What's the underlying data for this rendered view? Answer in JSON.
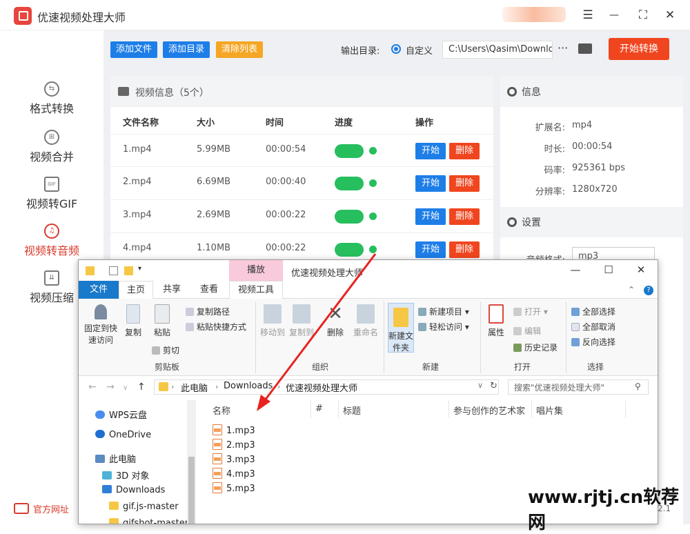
{
  "app": {
    "title": "优速视频处理大师",
    "window_controls": {
      "menu": "☰",
      "minimize": "—",
      "maximize": "⛶",
      "close": "✕"
    }
  },
  "sidebar": {
    "items": [
      {
        "label": "格式转换",
        "icon": "swap-icon",
        "glyph": "⇆",
        "active": false
      },
      {
        "label": "视频合并",
        "icon": "merge-icon",
        "glyph": "⊞",
        "active": false
      },
      {
        "label": "视频转GIF",
        "icon": "gif-icon",
        "glyph": "GIF",
        "active": false
      },
      {
        "label": "视频转音频",
        "icon": "audio-icon",
        "glyph": "♫",
        "active": true
      },
      {
        "label": "视频压缩",
        "icon": "compress-icon",
        "glyph": "⇊",
        "active": false
      }
    ],
    "official_site": "官方网址"
  },
  "toolbar": {
    "add_file": "添加文件",
    "add_dir": "添加目录",
    "clear_list": "清除列表",
    "output_label": "输出目录:",
    "radio_label": "自定义",
    "output_path": "C:\\Users\\Qasim\\Downloads",
    "more": "···",
    "start_all": "开始转换"
  },
  "video_panel": {
    "header": "视频信息（5个）",
    "columns": [
      "文件名称",
      "大小",
      "时间",
      "进度",
      "操作"
    ],
    "rows": [
      {
        "name": "1.mp4",
        "size": "5.99MB",
        "time": "00:00:54",
        "progress": 1.0
      },
      {
        "name": "2.mp4",
        "size": "6.69MB",
        "time": "00:00:40",
        "progress": 1.0
      },
      {
        "name": "3.mp4",
        "size": "2.69MB",
        "time": "00:00:22",
        "progress": 1.0
      },
      {
        "name": "4.mp4",
        "size": "1.10MB",
        "time": "00:00:22",
        "progress": 1.0
      }
    ],
    "start_label": "开始",
    "delete_label": "删除"
  },
  "info_panel": {
    "header": "信息",
    "fields": [
      {
        "key": "扩展名:",
        "value": "mp4"
      },
      {
        "key": "时长:",
        "value": "00:00:54"
      },
      {
        "key": "码率:",
        "value": "925361 bps"
      },
      {
        "key": "分辨率:",
        "value": "1280x720"
      }
    ],
    "settings_header": "设置",
    "audio_format_label": "音频格式:",
    "audio_format_value": "mp3"
  },
  "explorer": {
    "context_tab": "播放",
    "window_title": "优速视频处理大师",
    "tabs": [
      "文件",
      "主页",
      "共享",
      "查看",
      "视频工具"
    ],
    "ribbon": {
      "clipboard": {
        "pin": "固定到快速访问",
        "copy": "复制",
        "paste": "粘贴",
        "copy_path": "复制路径",
        "paste_shortcut": "粘贴快捷方式",
        "cut": "剪切",
        "group": "剪贴板"
      },
      "organize": {
        "move_to": "移动到",
        "copy_to": "复制到",
        "delete": "删除",
        "rename": "重命名",
        "group": "组织"
      },
      "new": {
        "new_folder": "新建文件夹",
        "new_item": "新建项目",
        "easy_access": "轻松访问",
        "group": "新建"
      },
      "open": {
        "properties": "属性",
        "open": "打开",
        "edit": "编辑",
        "history": "历史记录",
        "group": "打开"
      },
      "select": {
        "select_all": "全部选择",
        "select_none": "全部取消",
        "invert": "反向选择",
        "group": "选择"
      }
    },
    "breadcrumb": [
      "此电脑",
      "Downloads",
      "优速视频处理大师"
    ],
    "search_placeholder": "搜索\"优速视频处理大师\"",
    "nav": [
      {
        "label": "WPS云盘",
        "icon": "cloud-icon"
      },
      {
        "label": "OneDrive",
        "icon": "onedrive-icon"
      },
      {
        "label": "此电脑",
        "icon": "computer-icon"
      },
      {
        "label": "3D 对象",
        "icon": "3d-icon"
      },
      {
        "label": "Downloads",
        "icon": "download-icon"
      },
      {
        "label": "gif.js-master",
        "icon": "folder-icon"
      },
      {
        "label": "gifshot-master",
        "icon": "folder-icon"
      }
    ],
    "columns": [
      "名称",
      "#",
      "标题",
      "参与创作的艺术家",
      "唱片集"
    ],
    "files": [
      "1.mp3",
      "2.mp3",
      "3.mp3",
      "4.mp3",
      "5.mp3"
    ]
  },
  "overlay": {
    "watermark": "www.rjtj.cn软荐网",
    "version": "2.1"
  },
  "colors": {
    "accent_red": "#f0461f",
    "accent_blue": "#1e7ee8",
    "clear_orange": "#f5a623",
    "success_green": "#27be5e",
    "explorer_file_tab": "#1979ca",
    "context_tab_pink": "#f9c9dc"
  }
}
